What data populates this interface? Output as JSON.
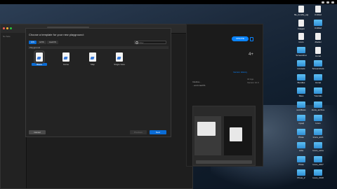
{
  "xcode": {
    "scheme_label": "Ready | Today at 11:48",
    "sidebar_filter": "No Sele"
  },
  "dialog": {
    "title": "Choose a template for your new playground:",
    "tabs": [
      "iOS",
      "tvOS",
      "macOS"
    ],
    "active_tab": "iOS",
    "filter_placeholder": "Filter",
    "section_label": "Playground",
    "templates": [
      {
        "label": "Blank",
        "selected": true
      },
      {
        "label": "Game",
        "selected": false
      },
      {
        "label": "Map",
        "selected": false
      },
      {
        "label": "Single View",
        "selected": false
      }
    ],
    "buttons": {
      "cancel": "Cancel",
      "previous": "Previous",
      "next": "Next"
    }
  },
  "app_store": {
    "update_label": "UPDATE",
    "rating": "4+",
    "link": "Version History",
    "meta_date": "3d Ago",
    "meta_version": "Version 10.0",
    "desc_lines": [
      "Intuitive...",
      "...and macOS"
    ]
  },
  "desktop_icons": [
    {
      "label": "file_bundle_appliq_Xcode",
      "type": "file"
    },
    {
      "label": "Untitled",
      "type": "file"
    },
    {
      "label": "Images",
      "type": "file"
    },
    {
      "label": "Untitled",
      "type": "folder"
    },
    {
      "label": "icons",
      "type": "file"
    },
    {
      "label": "JGetter",
      "type": "file"
    },
    {
      "label": "Screenshot",
      "type": "folder"
    },
    {
      "label": "Iconat",
      "type": "file"
    },
    {
      "label": "iconsets",
      "type": "folder"
    },
    {
      "label": "Screenshots",
      "type": "folder"
    },
    {
      "label": "Bundles",
      "type": "folder"
    },
    {
      "label": "Iconat",
      "type": "folder"
    },
    {
      "label": "Sites",
      "type": "folder"
    },
    {
      "label": "Tutorials",
      "type": "folder"
    },
    {
      "label": "workflows",
      "type": "folder"
    },
    {
      "label": "Icons_archive",
      "type": "folder"
    },
    {
      "label": "mysql",
      "type": "folder"
    },
    {
      "label": "Icons",
      "type": "folder"
    },
    {
      "label": "Photo",
      "type": "folder"
    },
    {
      "label": "Icons_arch",
      "type": "folder"
    },
    {
      "label": "Jobs",
      "type": "folder"
    },
    {
      "label": "Icons_extra",
      "type": "folder"
    },
    {
      "label": "Photo",
      "type": "folder"
    },
    {
      "label": "Icons_2017",
      "type": "folder"
    },
    {
      "label": "Photo_2",
      "type": "folder"
    },
    {
      "label": "Icons_2018",
      "type": "folder"
    }
  ],
  "colors": {
    "accent": "#0a6cd6",
    "app_store_blue": "#0a84ff"
  }
}
